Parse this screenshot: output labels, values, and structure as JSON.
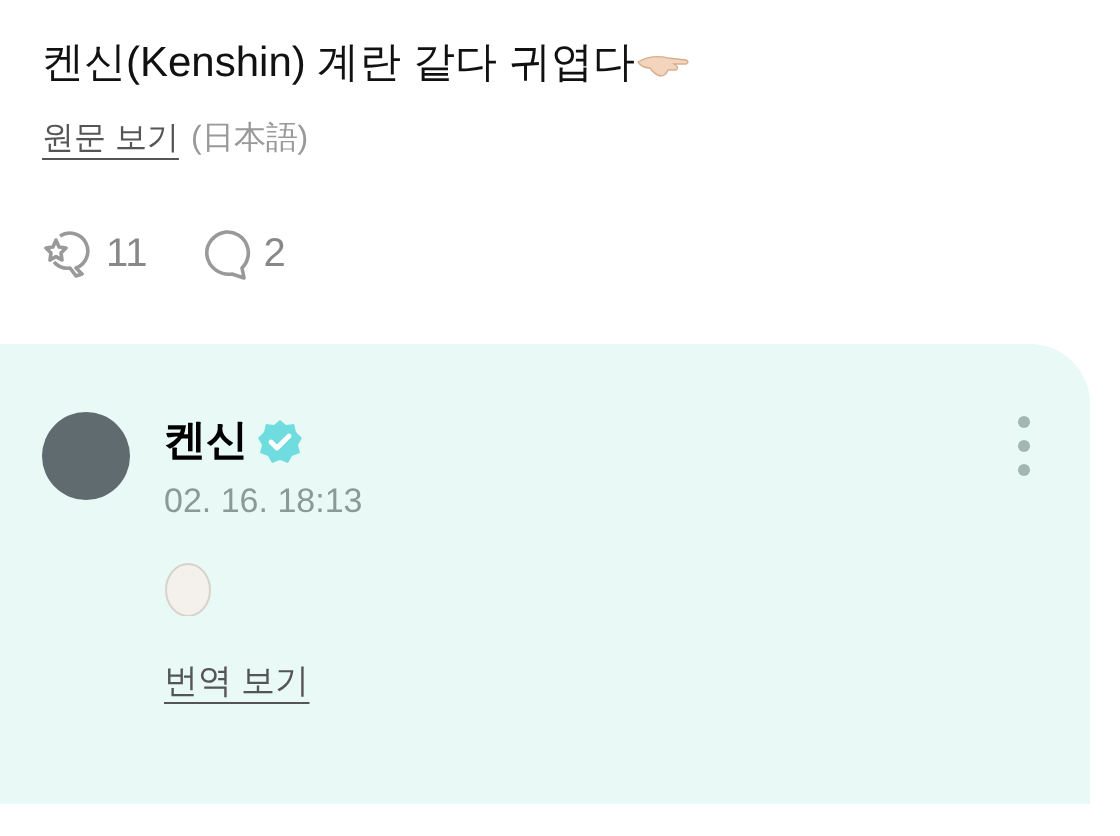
{
  "post": {
    "title": "켄신(Kenshin) 계란 같다 귀엽다",
    "view_original": "원문 보기",
    "language": "(日本語)",
    "reactions": [
      {
        "kind": "cheer",
        "count": "11"
      },
      {
        "kind": "comment",
        "count": "2"
      }
    ]
  },
  "comment": {
    "author": "켄신",
    "verified": true,
    "time": "02. 16. 18:13",
    "translate": "번역 보기"
  }
}
